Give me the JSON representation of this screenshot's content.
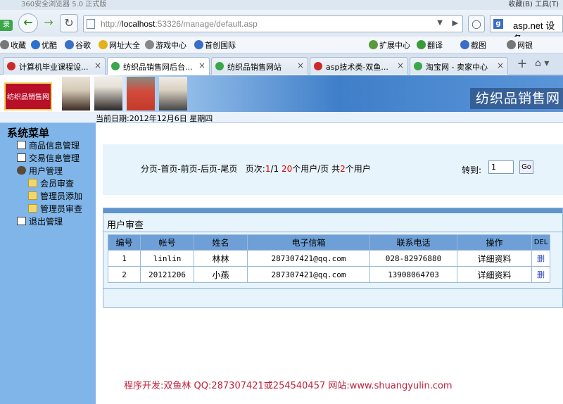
{
  "browser": {
    "title": "360安全浏览器 5.0 正式版",
    "menu_right": "收藏(B)   工具(T)",
    "login_badge": "录",
    "url_prefix": "http://",
    "url_host": "localhost",
    "url_rest": ":53326/manage/default.asp",
    "search_text": "asp.net 设备",
    "bookmarks": [
      {
        "label": "收藏",
        "color": "#777777"
      },
      {
        "label": "优酷",
        "color": "#2b6fd0"
      },
      {
        "label": "谷歌",
        "color": "#3a6fc8"
      },
      {
        "label": "网址大全",
        "color": "#e2b21a"
      },
      {
        "label": "游戏中心",
        "color": "#888888"
      },
      {
        "label": "首创国际",
        "color": "#3a6fc8"
      },
      {
        "label": "扩展中心",
        "color": "#5a9a3a"
      },
      {
        "label": "翻译",
        "color": "#3a9a3a"
      },
      {
        "label": "截图",
        "color": "#3a6fc8"
      },
      {
        "label": "网银",
        "color": "#777777"
      }
    ],
    "tabs": [
      {
        "label": "计算机毕业课程设...",
        "active": false,
        "color": "#cc2a2a"
      },
      {
        "label": "纺织品销售网后台...",
        "active": true,
        "color": "#3aa74a"
      },
      {
        "label": "纺织品销售网站",
        "active": false,
        "color": "#3aa74a"
      },
      {
        "label": "asp技术类-双鱼...",
        "active": false,
        "color": "#cc2a2a"
      },
      {
        "label": "淘宝网 - 卖家中心",
        "active": false,
        "color": "#3aa74a"
      }
    ]
  },
  "site": {
    "logo_text": "纺织品销售网",
    "title": "纺织品销售网",
    "date_text": "当前日期:2012年12月6日 星期四"
  },
  "sidebar": {
    "title": "系统菜单",
    "items": [
      {
        "label": "商品信息管理",
        "icon": "document-icon",
        "level": 0
      },
      {
        "label": "交易信息管理",
        "icon": "document-icon",
        "level": 0
      },
      {
        "label": "用户管理",
        "icon": "user-icon",
        "level": 0
      },
      {
        "label": "会员审查",
        "icon": "folder-icon",
        "level": 1
      },
      {
        "label": "管理员添加",
        "icon": "folder-icon",
        "level": 1
      },
      {
        "label": "管理员审查",
        "icon": "folder-icon",
        "level": 1
      },
      {
        "label": "退出管理",
        "icon": "document-icon",
        "level": 0
      }
    ]
  },
  "pager": {
    "nav": "分页-首页-前页-后页-尾页",
    "page_label": "页次:",
    "page_current": "1",
    "page_total": "/1",
    "per_page": "20",
    "per_page_suffix": "个用户/页 共",
    "total": "2",
    "total_suffix": "个用户",
    "goto_label": "转到:",
    "goto_value": "1",
    "go_label": "Go"
  },
  "users": {
    "section_title": "用户审查",
    "columns": [
      "编号",
      "帐号",
      "姓名",
      "电子信箱",
      "联系电话",
      "操作",
      "DEL"
    ],
    "rows": [
      {
        "id": "1",
        "account": "linlin",
        "name": "林林",
        "email": "287307421@qq.com",
        "phone": "028-82976880",
        "action": "详细资料",
        "del": "删"
      },
      {
        "id": "2",
        "account": "20121206",
        "name": "小燕",
        "email": "287307421@qq.com",
        "phone": "13908064703",
        "action": "详细资料",
        "del": "删"
      }
    ]
  },
  "footer": "程序开发:双鱼林 QQ:287307421或254540457 网站:www.shuangyulin.com"
}
